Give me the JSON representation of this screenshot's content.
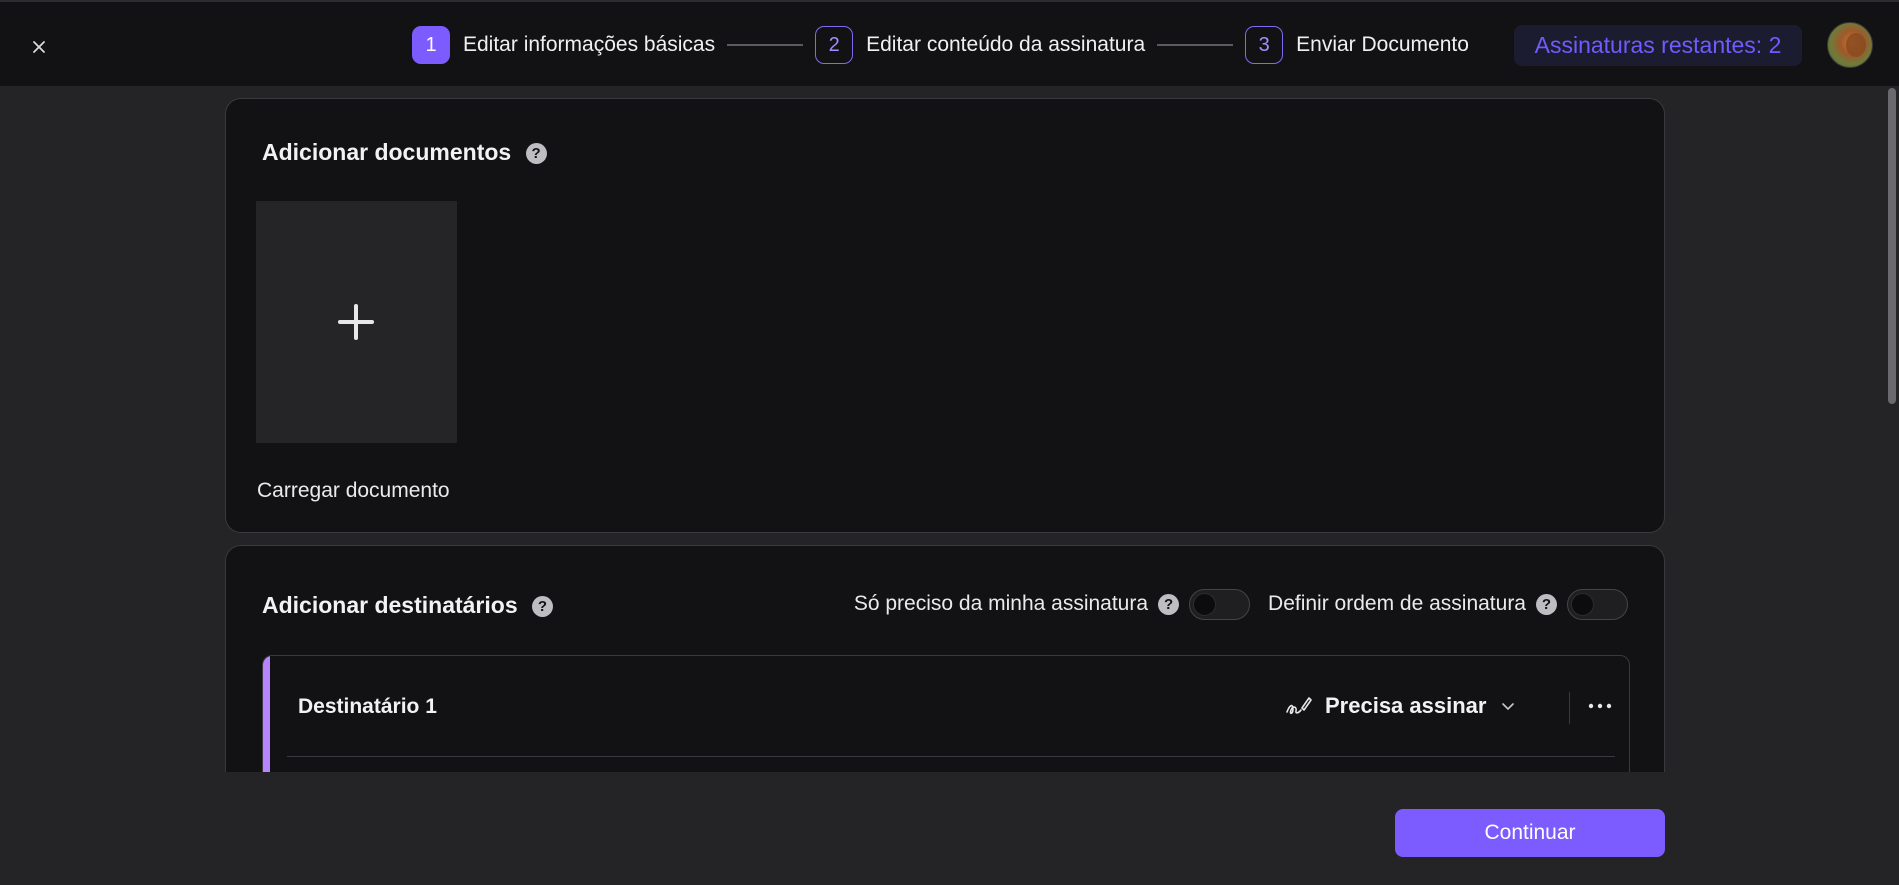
{
  "header": {
    "close_icon": "close-icon",
    "steps": [
      {
        "number": "1",
        "label": "Editar informações básicas",
        "active": true
      },
      {
        "number": "2",
        "label": "Editar conteúdo da assinatura",
        "active": false
      },
      {
        "number": "3",
        "label": "Enviar Documento",
        "active": false
      }
    ],
    "remaining_label": "Assinaturas restantes: 2",
    "avatar": "user-avatar"
  },
  "documents": {
    "title": "Adicionar documentos",
    "help_icon": "?",
    "upload_label": "Carregar documento",
    "upload_icon": "plus-icon"
  },
  "recipients": {
    "title": "Adicionar destinatários",
    "help_icon": "?",
    "only_mine_label": "Só preciso da minha assinatura",
    "only_mine_on": false,
    "set_order_label": "Definir ordem de assinatura",
    "set_order_on": false,
    "items": [
      {
        "name": "Destinatário 1",
        "role": "Precisa assinar",
        "role_icon": "signature-pen-icon"
      }
    ]
  },
  "footer": {
    "continue_label": "Continuar"
  },
  "colors": {
    "accent": "#7c5cff",
    "background": "#242426",
    "card": "#121214",
    "recipient_marker": "#b685ff"
  }
}
